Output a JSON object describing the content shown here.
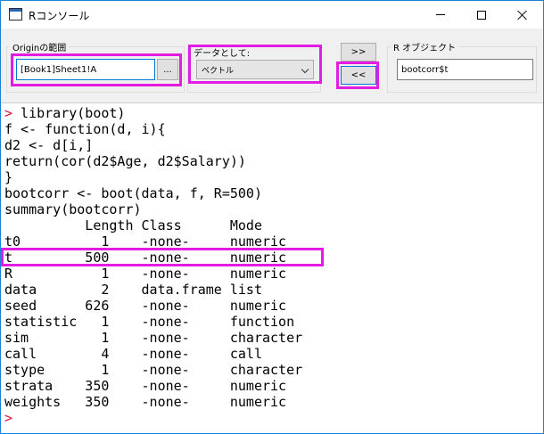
{
  "window": {
    "title": "Rコンソール"
  },
  "origin_range": {
    "label": "Originの範囲",
    "value": "[Book1]Sheet1!A",
    "browse_label": "..."
  },
  "as_data": {
    "label": "データとして:",
    "selected": "ベクトル"
  },
  "transfer": {
    "push_label": ">>",
    "pull_label": "<<"
  },
  "r_object": {
    "label": "R オブジェクト",
    "value": "bootcorr$t"
  },
  "console": {
    "prompt": ">",
    "lines": [
      " library(boot)",
      "f <- function(d, i){",
      "d2 <- d[i,]",
      "return(cor(d2$Age, d2$Salary))",
      "}",
      "bootcorr <- boot(data, f, R=500)",
      "summary(bootcorr)",
      "          Length Class      Mode",
      "t0          1    -none-     numeric",
      "t         500    -none-     numeric",
      "R           1    -none-     numeric",
      "data        2    data.frame list",
      "seed      626    -none-     numeric",
      "statistic   1    -none-     function",
      "sim         1    -none-     character",
      "call        4    -none-     call",
      "stype       1    -none-     character",
      "strata    350    -none-     numeric",
      "weights   350    -none-     numeric"
    ]
  },
  "colors": {
    "highlight": "#e21ce0",
    "prompt": "#e0102f",
    "focus_border": "#0078d7"
  }
}
